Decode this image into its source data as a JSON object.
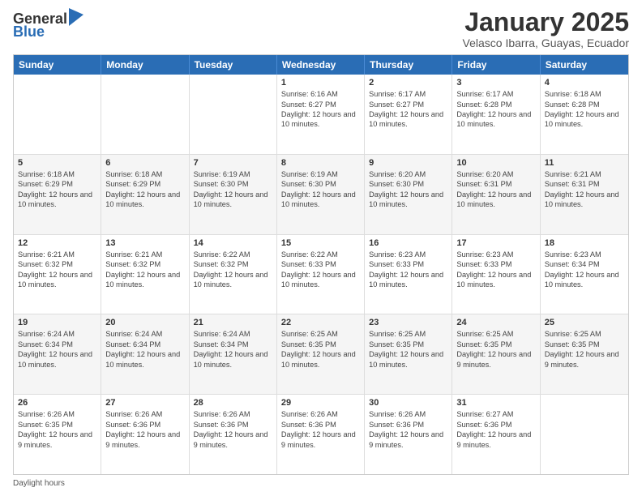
{
  "logo": {
    "general": "General",
    "blue": "Blue"
  },
  "header": {
    "month": "January 2025",
    "location": "Velasco Ibarra, Guayas, Ecuador"
  },
  "days_of_week": [
    "Sunday",
    "Monday",
    "Tuesday",
    "Wednesday",
    "Thursday",
    "Friday",
    "Saturday"
  ],
  "weeks": [
    [
      {
        "day": "",
        "sunrise": "",
        "sunset": "",
        "daylight": ""
      },
      {
        "day": "",
        "sunrise": "",
        "sunset": "",
        "daylight": ""
      },
      {
        "day": "",
        "sunrise": "",
        "sunset": "",
        "daylight": ""
      },
      {
        "day": "1",
        "sunrise": "Sunrise: 6:16 AM",
        "sunset": "Sunset: 6:27 PM",
        "daylight": "Daylight: 12 hours and 10 minutes."
      },
      {
        "day": "2",
        "sunrise": "Sunrise: 6:17 AM",
        "sunset": "Sunset: 6:27 PM",
        "daylight": "Daylight: 12 hours and 10 minutes."
      },
      {
        "day": "3",
        "sunrise": "Sunrise: 6:17 AM",
        "sunset": "Sunset: 6:28 PM",
        "daylight": "Daylight: 12 hours and 10 minutes."
      },
      {
        "day": "4",
        "sunrise": "Sunrise: 6:18 AM",
        "sunset": "Sunset: 6:28 PM",
        "daylight": "Daylight: 12 hours and 10 minutes."
      }
    ],
    [
      {
        "day": "5",
        "sunrise": "Sunrise: 6:18 AM",
        "sunset": "Sunset: 6:29 PM",
        "daylight": "Daylight: 12 hours and 10 minutes."
      },
      {
        "day": "6",
        "sunrise": "Sunrise: 6:18 AM",
        "sunset": "Sunset: 6:29 PM",
        "daylight": "Daylight: 12 hours and 10 minutes."
      },
      {
        "day": "7",
        "sunrise": "Sunrise: 6:19 AM",
        "sunset": "Sunset: 6:30 PM",
        "daylight": "Daylight: 12 hours and 10 minutes."
      },
      {
        "day": "8",
        "sunrise": "Sunrise: 6:19 AM",
        "sunset": "Sunset: 6:30 PM",
        "daylight": "Daylight: 12 hours and 10 minutes."
      },
      {
        "day": "9",
        "sunrise": "Sunrise: 6:20 AM",
        "sunset": "Sunset: 6:30 PM",
        "daylight": "Daylight: 12 hours and 10 minutes."
      },
      {
        "day": "10",
        "sunrise": "Sunrise: 6:20 AM",
        "sunset": "Sunset: 6:31 PM",
        "daylight": "Daylight: 12 hours and 10 minutes."
      },
      {
        "day": "11",
        "sunrise": "Sunrise: 6:21 AM",
        "sunset": "Sunset: 6:31 PM",
        "daylight": "Daylight: 12 hours and 10 minutes."
      }
    ],
    [
      {
        "day": "12",
        "sunrise": "Sunrise: 6:21 AM",
        "sunset": "Sunset: 6:32 PM",
        "daylight": "Daylight: 12 hours and 10 minutes."
      },
      {
        "day": "13",
        "sunrise": "Sunrise: 6:21 AM",
        "sunset": "Sunset: 6:32 PM",
        "daylight": "Daylight: 12 hours and 10 minutes."
      },
      {
        "day": "14",
        "sunrise": "Sunrise: 6:22 AM",
        "sunset": "Sunset: 6:32 PM",
        "daylight": "Daylight: 12 hours and 10 minutes."
      },
      {
        "day": "15",
        "sunrise": "Sunrise: 6:22 AM",
        "sunset": "Sunset: 6:33 PM",
        "daylight": "Daylight: 12 hours and 10 minutes."
      },
      {
        "day": "16",
        "sunrise": "Sunrise: 6:23 AM",
        "sunset": "Sunset: 6:33 PM",
        "daylight": "Daylight: 12 hours and 10 minutes."
      },
      {
        "day": "17",
        "sunrise": "Sunrise: 6:23 AM",
        "sunset": "Sunset: 6:33 PM",
        "daylight": "Daylight: 12 hours and 10 minutes."
      },
      {
        "day": "18",
        "sunrise": "Sunrise: 6:23 AM",
        "sunset": "Sunset: 6:34 PM",
        "daylight": "Daylight: 12 hours and 10 minutes."
      }
    ],
    [
      {
        "day": "19",
        "sunrise": "Sunrise: 6:24 AM",
        "sunset": "Sunset: 6:34 PM",
        "daylight": "Daylight: 12 hours and 10 minutes."
      },
      {
        "day": "20",
        "sunrise": "Sunrise: 6:24 AM",
        "sunset": "Sunset: 6:34 PM",
        "daylight": "Daylight: 12 hours and 10 minutes."
      },
      {
        "day": "21",
        "sunrise": "Sunrise: 6:24 AM",
        "sunset": "Sunset: 6:34 PM",
        "daylight": "Daylight: 12 hours and 10 minutes."
      },
      {
        "day": "22",
        "sunrise": "Sunrise: 6:25 AM",
        "sunset": "Sunset: 6:35 PM",
        "daylight": "Daylight: 12 hours and 10 minutes."
      },
      {
        "day": "23",
        "sunrise": "Sunrise: 6:25 AM",
        "sunset": "Sunset: 6:35 PM",
        "daylight": "Daylight: 12 hours and 10 minutes."
      },
      {
        "day": "24",
        "sunrise": "Sunrise: 6:25 AM",
        "sunset": "Sunset: 6:35 PM",
        "daylight": "Daylight: 12 hours and 9 minutes."
      },
      {
        "day": "25",
        "sunrise": "Sunrise: 6:25 AM",
        "sunset": "Sunset: 6:35 PM",
        "daylight": "Daylight: 12 hours and 9 minutes."
      }
    ],
    [
      {
        "day": "26",
        "sunrise": "Sunrise: 6:26 AM",
        "sunset": "Sunset: 6:35 PM",
        "daylight": "Daylight: 12 hours and 9 minutes."
      },
      {
        "day": "27",
        "sunrise": "Sunrise: 6:26 AM",
        "sunset": "Sunset: 6:36 PM",
        "daylight": "Daylight: 12 hours and 9 minutes."
      },
      {
        "day": "28",
        "sunrise": "Sunrise: 6:26 AM",
        "sunset": "Sunset: 6:36 PM",
        "daylight": "Daylight: 12 hours and 9 minutes."
      },
      {
        "day": "29",
        "sunrise": "Sunrise: 6:26 AM",
        "sunset": "Sunset: 6:36 PM",
        "daylight": "Daylight: 12 hours and 9 minutes."
      },
      {
        "day": "30",
        "sunrise": "Sunrise: 6:26 AM",
        "sunset": "Sunset: 6:36 PM",
        "daylight": "Daylight: 12 hours and 9 minutes."
      },
      {
        "day": "31",
        "sunrise": "Sunrise: 6:27 AM",
        "sunset": "Sunset: 6:36 PM",
        "daylight": "Daylight: 12 hours and 9 minutes."
      },
      {
        "day": "",
        "sunrise": "",
        "sunset": "",
        "daylight": ""
      }
    ]
  ],
  "footer": {
    "daylight_label": "Daylight hours"
  }
}
